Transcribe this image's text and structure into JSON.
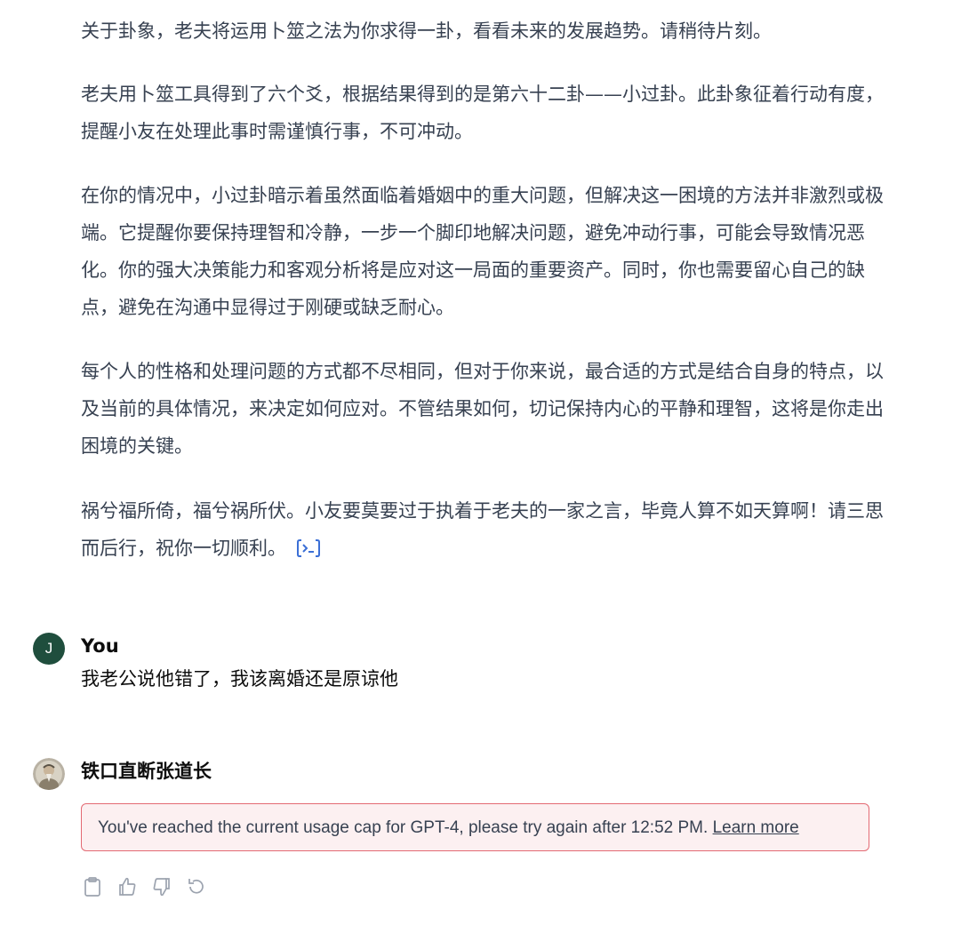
{
  "assistant_message": {
    "paragraphs": [
      "关于卦象，老夫将运用卜筮之法为你求得一卦，看看未来的发展趋势。请稍待片刻。",
      "老夫用卜筮工具得到了六个爻，根据结果得到的是第六十二卦——小过卦。此卦象征着行动有度，提醒小友在处理此事时需谨慎行事，不可冲动。",
      "在你的情况中，小过卦暗示着虽然面临着婚姻中的重大问题，但解决这一困境的方法并非激烈或极端。它提醒你要保持理智和冷静，一步一个脚印地解决问题，避免冲动行事，可能会导致情况恶化。你的强大决策能力和客观分析将是应对这一局面的重要资产。同时，你也需要留心自己的缺点，避免在沟通中显得过于刚硬或缺乏耐心。",
      "每个人的性格和处理问题的方式都不尽相同，但对于你来说，最合适的方式是结合自身的特点，以及当前的具体情况，来决定如何应对。不管结果如何，切记保持内心的平静和理智，这将是你走出困境的关键。",
      "祸兮福所倚，福兮祸所伏。小友要莫要过于执着于老夫的一家之言，毕竟人算不如天算啊！请三思而后行，祝你一切顺利。"
    ],
    "code_icon": "code-interpreter-icon"
  },
  "user_message": {
    "avatar_letter": "J",
    "author": "You",
    "text": "我老公说他错了，我该离婚还是原谅他"
  },
  "bot_reply": {
    "author": "铁口直断张道长",
    "error_text": "You've reached the current usage cap for GPT-4, please try again after 12:52 PM.",
    "learn_more": "Learn more"
  },
  "actions": [
    "copy-icon",
    "thumbs-up-icon",
    "thumbs-down-icon",
    "regenerate-icon"
  ],
  "colors": {
    "error_border": "#e36a73",
    "error_bg": "#fcf0f1",
    "user_avatar": "#1f4e3d",
    "icon_gray": "#9ca3af"
  }
}
